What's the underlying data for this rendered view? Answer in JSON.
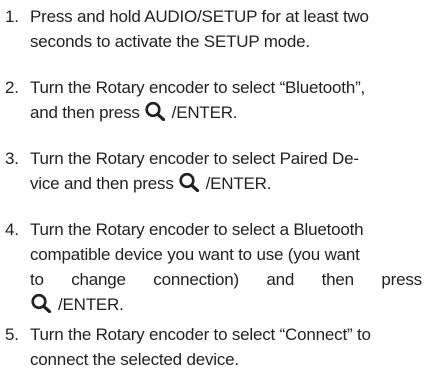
{
  "steps": [
    {
      "number": "1.",
      "line1": "Press and hold AUDIO/SETUP for at least two",
      "line2": "seconds to activate the SETUP mode."
    },
    {
      "number": "2.",
      "line1": "Turn the Rotary encoder to select “Bluetooth”,",
      "line2_before": "and then press",
      "line2_after": "/ENTER."
    },
    {
      "number": "3.",
      "line1": "Turn the Rotary encoder to select Paired De-",
      "line2_before": "vice and then press",
      "line2_after": "/ENTER."
    },
    {
      "number": "4.",
      "line1": "Turn the Rotary encoder to select a Bluetooth",
      "line2": "compatible device you want to use (you want",
      "line3_words": [
        "to",
        "change",
        "connection)",
        "and",
        "then",
        "press"
      ],
      "line4_after": "/ENTER."
    },
    {
      "number": "5.",
      "line1": "Turn the Rotary encoder to select “Connect” to",
      "line2": "connect the selected device."
    }
  ],
  "icons": {
    "enter_icon": "magnifier-icon"
  }
}
